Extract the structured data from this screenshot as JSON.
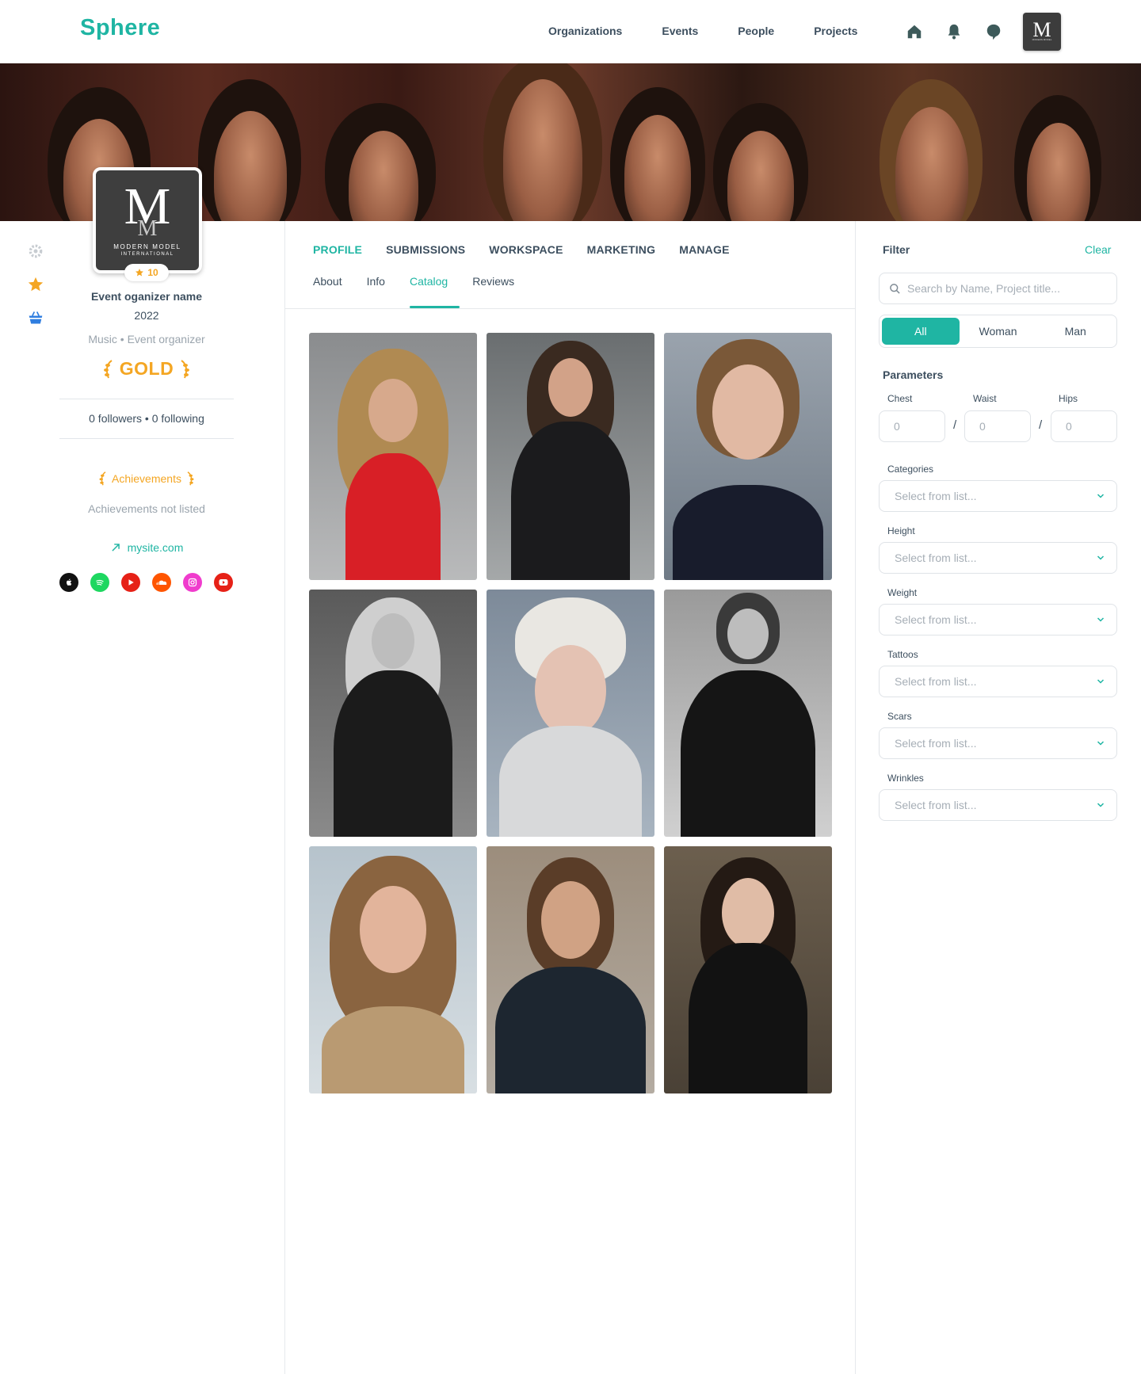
{
  "app": {
    "logo": "Sphere"
  },
  "nav": {
    "items": [
      "Organizations",
      "Events",
      "People",
      "Projects"
    ]
  },
  "top_icons": [
    "home-icon",
    "bell-icon",
    "chat-icon"
  ],
  "profile": {
    "logo_text": "M",
    "logo_brand": "MODERN MODEL",
    "logo_brand2": "INTERNATIONAL",
    "rating": "10",
    "name": "Event oganizer name",
    "year": "2022",
    "category": "Music • Event organizer",
    "tier": "GOLD",
    "followers": "0 followers • 0 following",
    "achievements_title": "Achievements",
    "achievements_empty": "Achievements not listed",
    "website": "mysite.com",
    "socials": [
      "apple-music-icon",
      "spotify-icon",
      "youtube-icon",
      "soundcloud-icon",
      "instagram-icon",
      "youtube-icon"
    ]
  },
  "tabs": {
    "main": [
      "PROFILE",
      "SUBMISSIONS",
      "WORKSPACE",
      "MARKETING",
      "MANAGE"
    ],
    "active_main": "PROFILE",
    "sub": [
      "About",
      "Info",
      "Catalog",
      "Reviews"
    ],
    "active_sub": "Catalog"
  },
  "gallery": {
    "photo_count": 9
  },
  "filter": {
    "title": "Filter",
    "clear": "Clear",
    "search_placeholder": "Search by Name, Project title...",
    "gender": [
      "All",
      "Woman",
      "Man"
    ],
    "active_gender": "All",
    "parameters_title": "Parameters",
    "params": [
      {
        "label": "Chest",
        "value": "0"
      },
      {
        "label": "Waist",
        "value": "0"
      },
      {
        "label": "Hips",
        "value": "0"
      }
    ],
    "selects": [
      {
        "label": "Categories",
        "placeholder": "Select from list..."
      },
      {
        "label": "Height",
        "placeholder": "Select from list..."
      },
      {
        "label": "Weight",
        "placeholder": "Select from list..."
      },
      {
        "label": "Tattoos",
        "placeholder": "Select from list..."
      },
      {
        "label": "Scars",
        "placeholder": "Select from list..."
      },
      {
        "label": "Wrinkles",
        "placeholder": "Select from list..."
      }
    ]
  },
  "colors": {
    "accent": "#1fb5a3",
    "gold": "#f4a623",
    "text": "#3d4f5f",
    "muted": "#a6aeb6"
  }
}
